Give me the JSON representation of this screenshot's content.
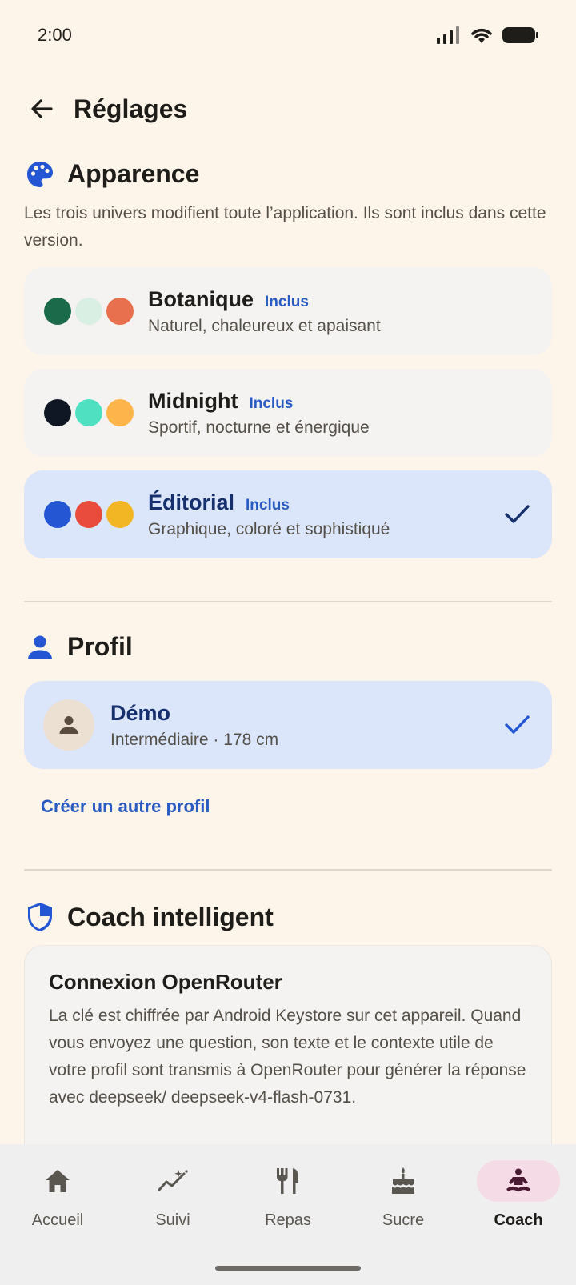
{
  "status": {
    "time": "2:00"
  },
  "app_bar": {
    "title": "Réglages"
  },
  "appearance": {
    "title": "Apparence",
    "description": "Les trois univers modifient toute l’application. Ils sont inclus dans cette version.",
    "themes": [
      {
        "name": "Botanique",
        "badge": "Inclus",
        "subtitle": "Naturel, chaleureux et apaisant",
        "colors": [
          "#1b6b4b",
          "#d9efe3",
          "#e8704e"
        ],
        "selected": false
      },
      {
        "name": "Midnight",
        "badge": "Inclus",
        "subtitle": "Sportif, nocturne et énergique",
        "colors": [
          "#0f1724",
          "#4fe0c2",
          "#fdb44a"
        ],
        "selected": false
      },
      {
        "name": "Éditorial",
        "badge": "Inclus",
        "subtitle": "Graphique, coloré et sophistiqué",
        "colors": [
          "#2456d4",
          "#e94c3c",
          "#f2b624"
        ],
        "selected": true
      }
    ]
  },
  "profile": {
    "title": "Profil",
    "current": {
      "name": "Démo",
      "subtitle": "Intermédiaire · 178 cm"
    },
    "create_link": "Créer un autre profil"
  },
  "coach": {
    "title": "Coach intelligent",
    "card_title": "Connexion OpenRouter",
    "card_body": "La clé est chiffrée par Android Keystore sur cet appareil. Quand vous envoyez une question, son texte et le contexte utile de votre profil sont transmis à OpenRouter pour générer la réponse avec deepseek/ deepseek-v4-flash-0731."
  },
  "nav": {
    "items": [
      {
        "label": "Accueil",
        "icon": "home-icon"
      },
      {
        "label": "Suivi",
        "icon": "trend-icon"
      },
      {
        "label": "Repas",
        "icon": "fork-knife-icon"
      },
      {
        "label": "Sucre",
        "icon": "cake-icon"
      },
      {
        "label": "Coach",
        "icon": "meditation-icon",
        "active": true
      }
    ]
  },
  "colors": {
    "accent": "#2a5bc2",
    "background": "#fdf4ea",
    "selected_card": "#dce6fb"
  }
}
